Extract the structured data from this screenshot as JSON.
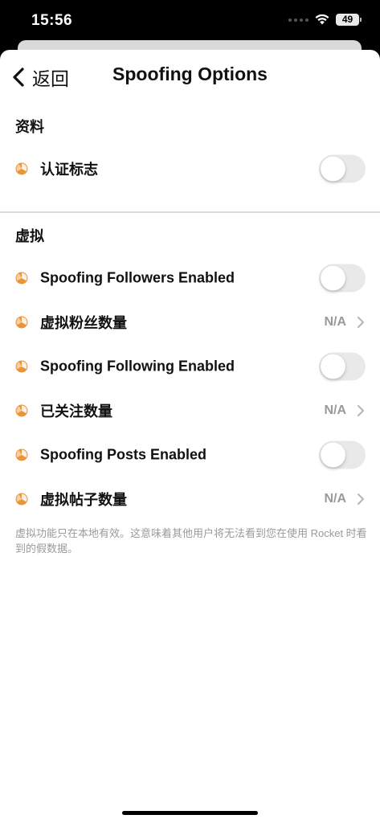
{
  "status_bar": {
    "time": "15:56",
    "battery": "49"
  },
  "nav": {
    "back_label": "返回",
    "title": "Spoofing Options"
  },
  "sections": [
    {
      "header": "资料",
      "rows": [
        {
          "label": "认证标志",
          "type": "toggle",
          "on": false
        }
      ]
    },
    {
      "header": "虚拟",
      "rows": [
        {
          "label": "Spoofing Followers Enabled",
          "type": "toggle",
          "on": false
        },
        {
          "label": "虚拟粉丝数量",
          "type": "value",
          "value": "N/A"
        },
        {
          "label": "Spoofing Following Enabled",
          "type": "toggle",
          "on": false
        },
        {
          "label": "已关注数量",
          "type": "value",
          "value": "N/A"
        },
        {
          "label": "Spoofing Posts Enabled",
          "type": "toggle",
          "on": false
        },
        {
          "label": "虚拟帖子数量",
          "type": "value",
          "value": "N/A"
        }
      ]
    }
  ],
  "footer_note": "虚拟功能只在本地有效。这意味着其他用户将无法看到您在使用 Rocket 时看到的假数据。",
  "colors": {
    "accent": "#e9953a",
    "toggle_off": "#e9e9ea",
    "secondary_text": "#9a9a9a"
  }
}
